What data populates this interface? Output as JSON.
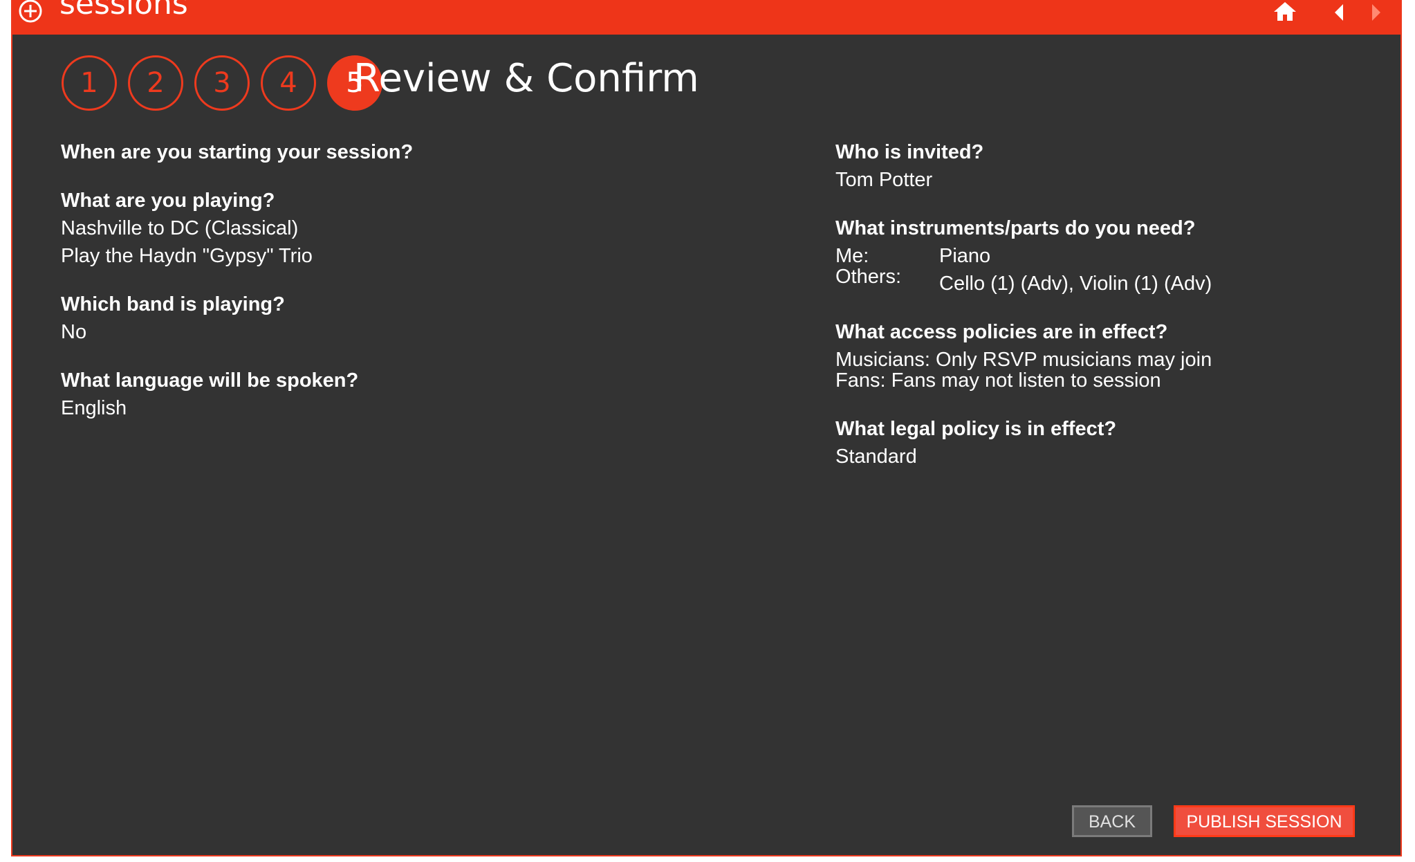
{
  "app": {
    "title": "sessions"
  },
  "nav": {
    "icons": [
      "home-icon",
      "back-arrow-icon",
      "forward-arrow-icon"
    ]
  },
  "steps": {
    "items": [
      "1",
      "2",
      "3",
      "4",
      "5"
    ],
    "active": "5",
    "title": "Review & Confirm"
  },
  "left": {
    "start_q": "When are you starting your session?",
    "playing_q": "What are you playing?",
    "playing_a1": "Nashville to DC (Classical)",
    "playing_a2": "Play the Haydn \"Gypsy\" Trio",
    "band_q": "Which band is playing?",
    "band_a": "No",
    "language_q": "What language will be spoken?",
    "language_a": "English"
  },
  "right": {
    "invited_q": "Who is invited?",
    "invited_a": "Tom Potter",
    "instruments_q": "What instruments/parts do you need?",
    "me_label": "Me:",
    "me_value": "Piano",
    "others_label": "Others:",
    "others_value": "Cello (1) (Adv), Violin (1) (Adv)",
    "access_q": "What access policies are in effect?",
    "access_a1": "Musicians: Only RSVP musicians may join",
    "access_a2": "Fans: Fans may not listen to session",
    "legal_q": "What legal policy is in effect?",
    "legal_a": "Standard"
  },
  "buttons": {
    "back": "BACK",
    "publish": "PUBLISH SESSION"
  },
  "colors": {
    "accent": "#ee3a1e",
    "background": "#333333",
    "text": "#ffffff"
  }
}
